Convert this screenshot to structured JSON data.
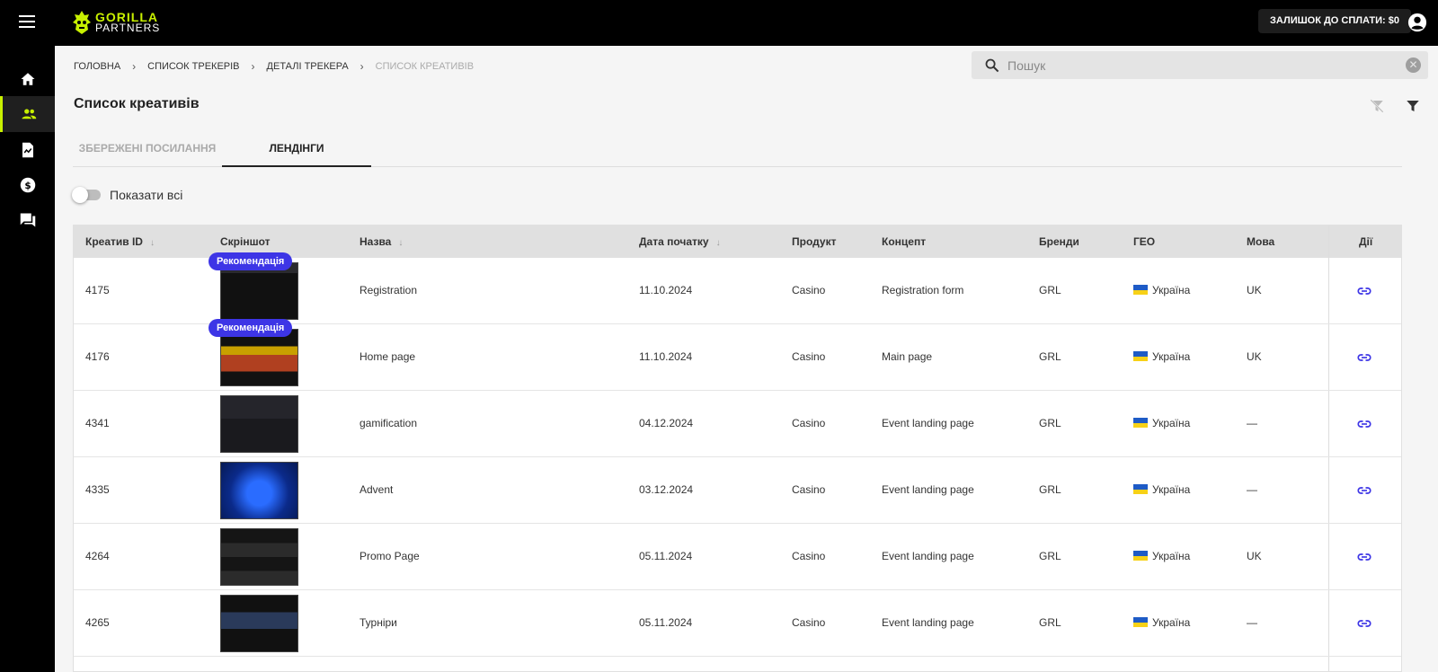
{
  "header": {
    "logo_line1": "GORILLA",
    "logo_line2": "PARTNERS",
    "balance": "ЗАЛИШОК ДО СПЛАТИ: $0",
    "accent": "#c8f000"
  },
  "sidebar": {
    "items": [
      {
        "name": "home-icon"
      },
      {
        "name": "users-icon",
        "active": true
      },
      {
        "name": "report-icon"
      },
      {
        "name": "dollar-icon"
      },
      {
        "name": "chat-icon"
      }
    ]
  },
  "breadcrumb": [
    "ГОЛОВНА",
    "СПИСОК ТРЕКЕРІВ",
    "ДЕТАЛІ ТРЕКЕРА",
    "СПИСОК КРЕАТИВІВ"
  ],
  "search": {
    "placeholder": "Пошук",
    "value": ""
  },
  "page_title": "Список креативів",
  "tabs": [
    {
      "label": "ЗБЕРЕЖЕНІ ПОСИЛАННЯ",
      "active": false
    },
    {
      "label": "ЛЕНДІНГИ",
      "active": true
    }
  ],
  "toggle": {
    "label": "Показати всі",
    "on": false
  },
  "table": {
    "columns": [
      "Креатив ID",
      "Скріншот",
      "Назва",
      "Дата початку",
      "Продукт",
      "Концепт",
      "Бренди",
      "ГЕО",
      "Мова",
      "Дії"
    ],
    "badge_label": "Рекомендація",
    "rows": [
      {
        "id": "4175",
        "recommended": true,
        "name": "Registration",
        "date": "11.10.2024",
        "product": "Casino",
        "concept": "Registration form",
        "brand": "GRL",
        "geo": "Україна",
        "lang": "UK"
      },
      {
        "id": "4176",
        "recommended": true,
        "name": "Home page",
        "date": "11.10.2024",
        "product": "Casino",
        "concept": "Main page",
        "brand": "GRL",
        "geo": "Україна",
        "lang": "UK"
      },
      {
        "id": "4341",
        "recommended": false,
        "name": "gamification",
        "date": "04.12.2024",
        "product": "Casino",
        "concept": "Event landing page",
        "brand": "GRL",
        "geo": "Україна",
        "lang": "—"
      },
      {
        "id": "4335",
        "recommended": false,
        "name": "Advent",
        "date": "03.12.2024",
        "product": "Casino",
        "concept": "Event landing page",
        "brand": "GRL",
        "geo": "Україна",
        "lang": "—"
      },
      {
        "id": "4264",
        "recommended": false,
        "name": "Promo Page",
        "date": "05.11.2024",
        "product": "Casino",
        "concept": "Event landing page",
        "brand": "GRL",
        "geo": "Україна",
        "lang": "UK"
      },
      {
        "id": "4265",
        "recommended": false,
        "name": "Турніри",
        "date": "05.11.2024",
        "product": "Casino",
        "concept": "Event landing page",
        "brand": "GRL",
        "geo": "Україна",
        "lang": "—"
      }
    ]
  },
  "colors": {
    "badge": "#3d35e6",
    "link": "#3d35e6",
    "flag_blue": "#1e5bc6",
    "flag_yellow": "#f7d117"
  }
}
